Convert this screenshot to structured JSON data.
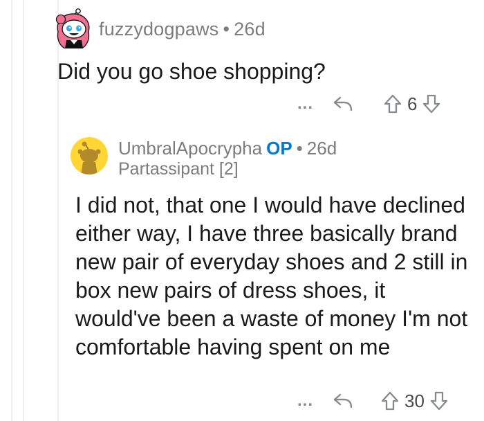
{
  "comments": [
    {
      "username": "fuzzydogpaws",
      "separator": "•",
      "age": "26d",
      "body": "Did you go shoe shopping?",
      "actions": {
        "more": "...",
        "score": "6"
      },
      "avatar_icon": "snoo-avatar-pink-hair-icon"
    },
    {
      "username": "UmbralApocrypha",
      "op_badge": "OP",
      "separator": "•",
      "age": "26d",
      "flair": "Partassipant [2]",
      "body": "I did not, that one I would have declined either way, I have three basically brand new pair of everyday shoes and 2 still in box new pairs of dress shoes, it would've been a waste of money I'm not comfortable having spent on me",
      "actions": {
        "more": "...",
        "score": "30"
      },
      "avatar_icon": "snoo-avatar-default-icon"
    }
  ],
  "colors": {
    "op_blue": "#0079d3",
    "meta_gray": "#7c7c7c",
    "icon_gray": "#878a8c",
    "default_avatar_bg": "#ffd635",
    "thread_line": "#edeff1"
  }
}
